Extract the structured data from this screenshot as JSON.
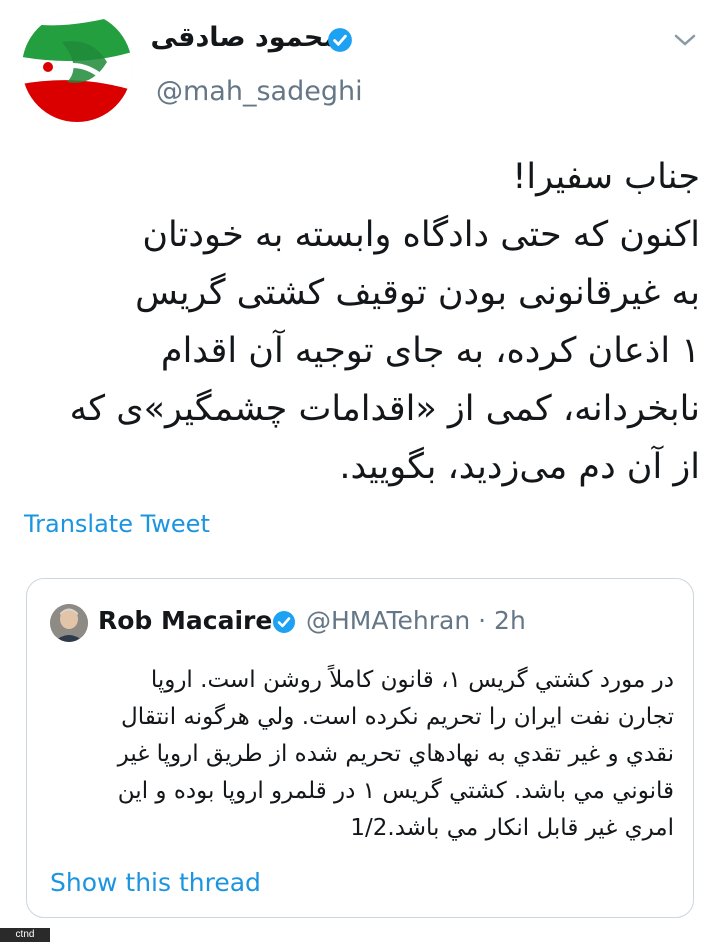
{
  "tweet": {
    "author": {
      "display_name": "محمود صادقی",
      "handle": "@mah_sadeghi",
      "verified": true,
      "avatar_icon": "iran-flag-calligraphy-avatar"
    },
    "menu_icon": "chevron-down-icon",
    "text_lines": [
      "جناب سفیرا!",
      "اکنون که حتی دادگاه وابسته به خودتان",
      "به غیرقانونی بودن توقیف کشتی گریس",
      "۱ اذعان کرده، به جای توجیه آن اقدام",
      "نابخردانه، کمی از «اقدامات چشمگیر»ی که",
      "از آن دم می‌زدید، بگویید."
    ],
    "translate_label": "Translate Tweet"
  },
  "quoted_tweet": {
    "author": {
      "display_name": "Rob Macaire",
      "verified": true,
      "avatar_icon": "profile-photo-avatar"
    },
    "meta": "@HMATehran · 2h",
    "text_lines": [
      "در مورد کشتي گريس ۱، قانون کاملاً روشن است. اروپا",
      "تجارن نفت ايران را تحريم نکرده است. ولي هرگونه انتقال",
      "نقدي و غير تقدي به نهادهاي تحريم شده از طريق اروپا غير",
      "قانوني مي باشد.  کشتي گريس ۱ در قلمرو اروپا بوده و اين",
      "امري غير قابل انکار مي باشد.1/2"
    ],
    "show_thread_label": "Show this thread"
  },
  "watermark": "ctnd",
  "colors": {
    "link": "#1b95e0",
    "muted": "#657786",
    "text": "#14171a",
    "verified": "#1da1f2",
    "border": "#ccd6dd"
  }
}
